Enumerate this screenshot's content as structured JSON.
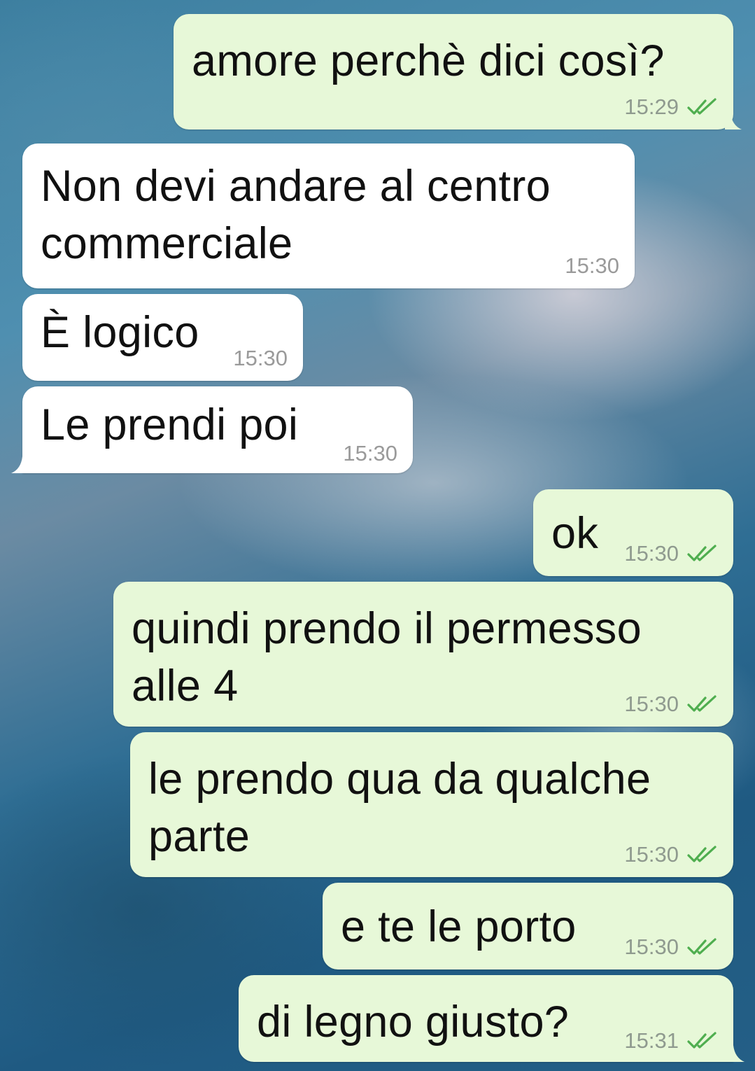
{
  "chat": {
    "messages": [
      {
        "direction": "outgoing",
        "text": "amore perchè dici così?",
        "time": "15:29",
        "status": "read"
      },
      {
        "direction": "incoming",
        "text": "Non devi andare al centro\ncommerciale",
        "time": "15:30"
      },
      {
        "direction": "incoming",
        "text": "È logico",
        "time": "15:30"
      },
      {
        "direction": "incoming",
        "text": "Le prendi poi",
        "time": "15:30"
      },
      {
        "direction": "outgoing",
        "text": "ok",
        "time": "15:30",
        "status": "read"
      },
      {
        "direction": "outgoing",
        "text": "quindi prendo il permesso\nalle 4",
        "time": "15:30",
        "status": "read"
      },
      {
        "direction": "outgoing",
        "text": "le prendo qua da qualche\nparte",
        "time": "15:30",
        "status": "read"
      },
      {
        "direction": "outgoing",
        "text": "e te le porto",
        "time": "15:30",
        "status": "read"
      },
      {
        "direction": "outgoing",
        "text": "di legno giusto?",
        "time": "15:31",
        "status": "read"
      }
    ]
  },
  "colors": {
    "outgoing_bubble": "#e7f8d8",
    "incoming_bubble": "#ffffff",
    "read_ticks": "#4fae4f"
  },
  "icons": {
    "read_status": "double-check-icon"
  }
}
